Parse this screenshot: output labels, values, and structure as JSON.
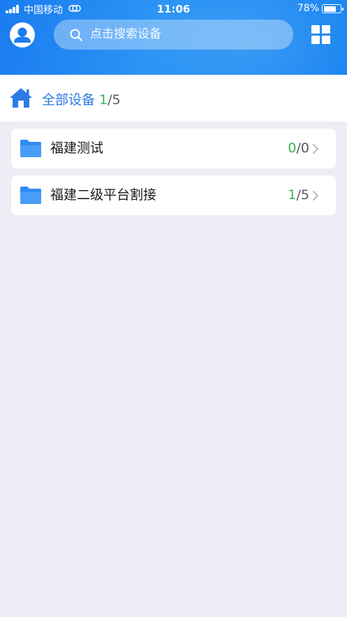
{
  "status_bar": {
    "carrier": "中国移动",
    "time": "11:06",
    "battery_percent": "78%",
    "battery_level": 0.78
  },
  "header": {
    "search_placeholder": "点击搜索设备",
    "avatar_icon": "user-avatar-icon",
    "grid_icon": "grid-view-icon",
    "background_color": "#1a7cf0"
  },
  "breadcrumb": {
    "title": "全部设备",
    "online": "1",
    "separator": "/",
    "total": "5"
  },
  "groups": [
    {
      "name": "福建测试",
      "online": "0",
      "separator": "/",
      "total": "0"
    },
    {
      "name": "福建二级平台割接",
      "online": "1",
      "separator": "/",
      "total": "5"
    }
  ],
  "colors": {
    "accent_blue": "#2a7be4",
    "online_green": "#38b549",
    "page_bg": "#ededf5"
  }
}
